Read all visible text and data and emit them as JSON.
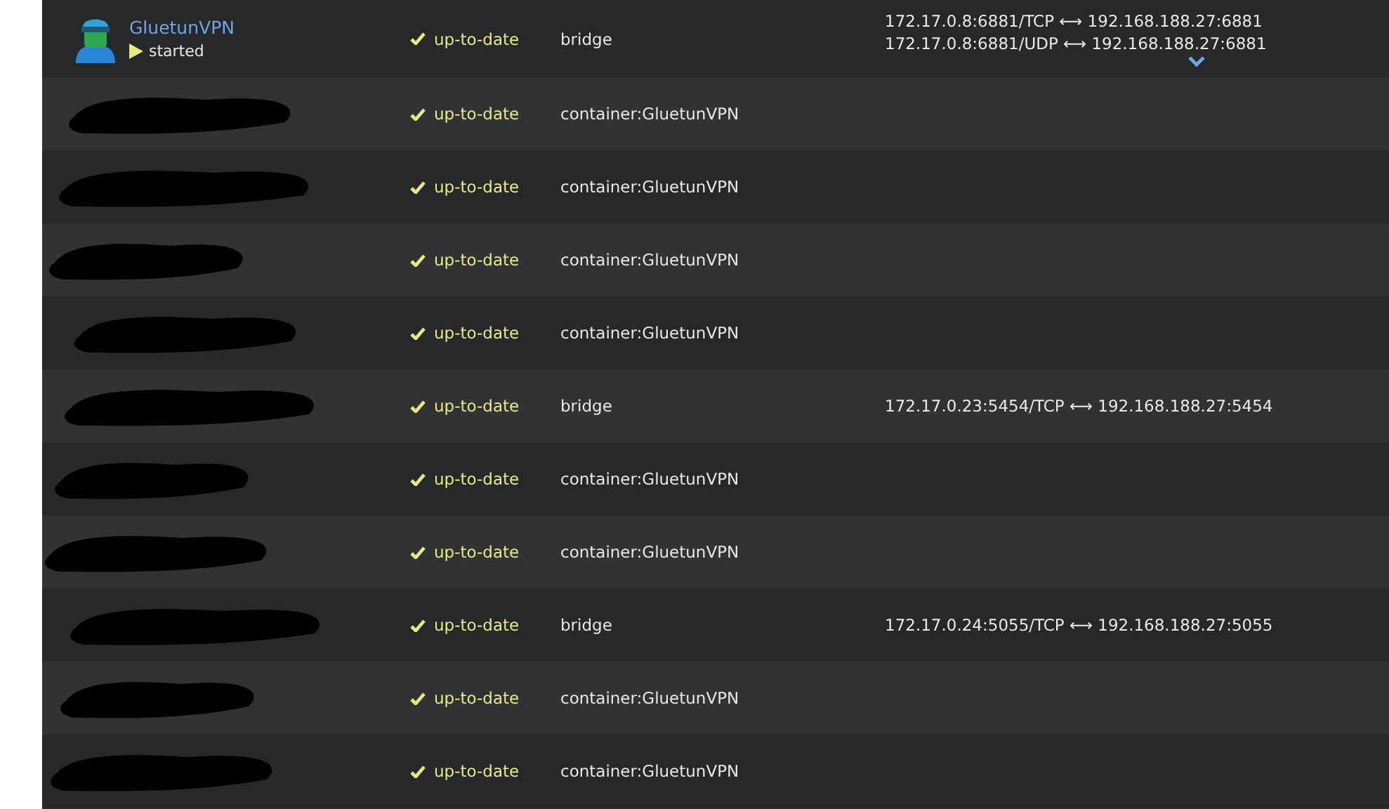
{
  "containers": [
    {
      "name": "GluetunVPN",
      "state": "started",
      "running": true,
      "redacted": false,
      "version": "up-to-date",
      "network": "bridge",
      "ports": [
        "172.17.0.8:6881/TCP ⟷ 192.168.188.27:6881",
        "172.17.0.8:6881/UDP ⟷ 192.168.188.27:6881"
      ],
      "more_ports": true
    },
    {
      "redacted": true,
      "version": "up-to-date",
      "network": "container:GluetunVPN"
    },
    {
      "redacted": true,
      "version": "up-to-date",
      "network": "container:GluetunVPN"
    },
    {
      "redacted": true,
      "version": "up-to-date",
      "network": "container:GluetunVPN"
    },
    {
      "redacted": true,
      "version": "up-to-date",
      "network": "container:GluetunVPN"
    },
    {
      "redacted": true,
      "version": "up-to-date",
      "network": "bridge",
      "ports": [
        "172.17.0.23:5454/TCP ⟷ 192.168.188.27:5454"
      ]
    },
    {
      "redacted": true,
      "version": "up-to-date",
      "network": "container:GluetunVPN"
    },
    {
      "redacted": true,
      "version": "up-to-date",
      "network": "container:GluetunVPN"
    },
    {
      "redacted": true,
      "version": "up-to-date",
      "network": "bridge",
      "ports": [
        "172.17.0.24:5055/TCP ⟷ 192.168.188.27:5055"
      ]
    },
    {
      "redacted": true,
      "version": "up-to-date",
      "network": "container:GluetunVPN"
    },
    {
      "redacted": true,
      "version": "up-to-date",
      "network": "container:GluetunVPN"
    }
  ]
}
